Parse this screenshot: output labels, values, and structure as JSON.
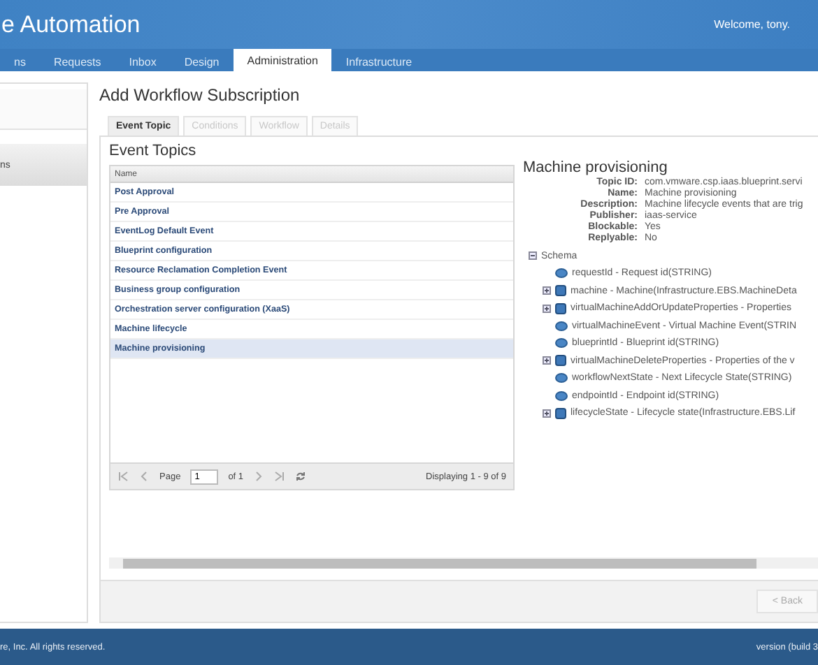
{
  "header": {
    "title": "e Automation",
    "welcome": "Welcome, tony."
  },
  "nav_tabs": [
    {
      "label": "ns",
      "selected": false
    },
    {
      "label": "Requests",
      "selected": false
    },
    {
      "label": "Inbox",
      "selected": false
    },
    {
      "label": "Design",
      "selected": false
    },
    {
      "label": "Administration",
      "selected": true
    },
    {
      "label": "Infrastructure",
      "selected": false
    }
  ],
  "sidebar": {
    "items": [
      {
        "label": "ns",
        "selected": true
      }
    ]
  },
  "page_title": "Add Workflow Subscription",
  "wizard_tabs": [
    {
      "label": "Event Topic",
      "selected": true,
      "disabled": false
    },
    {
      "label": "Conditions",
      "selected": false,
      "disabled": true
    },
    {
      "label": "Workflow",
      "selected": false,
      "disabled": true
    },
    {
      "label": "Details",
      "selected": false,
      "disabled": true
    }
  ],
  "section_title": "Event Topics",
  "table": {
    "columns": [
      "Name"
    ],
    "rows": [
      {
        "name": "Post Approval",
        "selected": false
      },
      {
        "name": "Pre Approval",
        "selected": false
      },
      {
        "name": "EventLog Default Event",
        "selected": false
      },
      {
        "name": "Blueprint configuration",
        "selected": false
      },
      {
        "name": "Resource Reclamation Completion Event",
        "selected": false
      },
      {
        "name": "Business group configuration",
        "selected": false
      },
      {
        "name": "Orchestration server configuration (XaaS)",
        "selected": false
      },
      {
        "name": "Machine lifecycle",
        "selected": false
      },
      {
        "name": "Machine provisioning",
        "selected": true
      }
    ]
  },
  "pager": {
    "page_label": "Page",
    "page": "1",
    "of": "of 1",
    "display": "Displaying 1 - 9 of 9"
  },
  "detail": {
    "title": "Machine provisioning",
    "fields": [
      {
        "label": "Topic ID:",
        "value": "com.vmware.csp.iaas.blueprint.servi"
      },
      {
        "label": "Name:",
        "value": "Machine provisioning"
      },
      {
        "label": "Description:",
        "value": "Machine lifecycle events that are trig"
      },
      {
        "label": "Publisher:",
        "value": "iaas-service"
      },
      {
        "label": "Blockable:",
        "value": "Yes"
      },
      {
        "label": "Replyable:",
        "value": "No"
      }
    ],
    "schema": {
      "label": "Schema",
      "expanded": true,
      "children": [
        {
          "kind": "leaf",
          "text": "requestId - Request id(STRING)"
        },
        {
          "kind": "object",
          "text": "machine - Machine(Infrastructure.EBS.MachineDeta"
        },
        {
          "kind": "object",
          "text": "virtualMachineAddOrUpdateProperties - Properties"
        },
        {
          "kind": "leaf",
          "text": "virtualMachineEvent - Virtual Machine Event(STRIN"
        },
        {
          "kind": "leaf",
          "text": "blueprintId - Blueprint id(STRING)"
        },
        {
          "kind": "object",
          "text": "virtualMachineDeleteProperties - Properties of the v"
        },
        {
          "kind": "leaf",
          "text": "workflowNextState - Next Lifecycle State(STRING)"
        },
        {
          "kind": "leaf",
          "text": "endpointId - Endpoint id(STRING)"
        },
        {
          "kind": "object",
          "text": "lifecycleState - Lifecycle state(Infrastructure.EBS.Lif"
        }
      ]
    }
  },
  "back_button": {
    "label": "< Back",
    "disabled": true
  },
  "footer": {
    "copyright": "re, Inc. All rights reserved.",
    "version": "version (build 3"
  }
}
